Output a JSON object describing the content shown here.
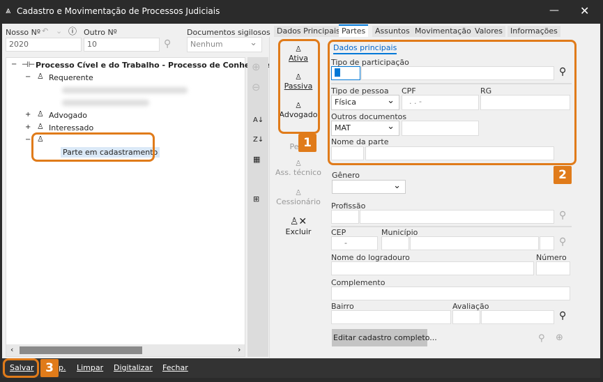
{
  "window": {
    "title": "Cadastro e Movimentação de Processos Judiciais",
    "minimize": "—",
    "maximize": "☐",
    "close": "✕"
  },
  "header": {
    "nosso_label": "Nosso Nº",
    "nosso_value": "2020",
    "outro_label": "Outro Nº",
    "outro_value": "10",
    "docs_label": "Documentos sigilosos",
    "docs_value": "Nenhum"
  },
  "tree": {
    "root": "Processo Cível e do Trabalho - Processo de Conhecimento",
    "nodes": [
      "Requerente",
      "Advogado",
      "Interessado"
    ],
    "new_child": "Parte em cadastramento",
    "expand": "+",
    "collapse": "−"
  },
  "tabs": [
    {
      "label": "Dados Principais"
    },
    {
      "label": "Partes"
    },
    {
      "label": "Assuntos"
    },
    {
      "label": "Movimentação"
    },
    {
      "label": "Valores"
    },
    {
      "label": "Informações"
    }
  ],
  "party_buttons": {
    "ativa": "Ativa",
    "passiva": "Passiva",
    "advogado": "Advogado",
    "perito": "Pe",
    "ass_tecnico": "Ass. técnico",
    "cessionario": "Cessionário",
    "excluir": "Excluir"
  },
  "form": {
    "subtab": "Dados principais",
    "tipo_participacao": "Tipo de participação",
    "tipo_pessoa": "Tipo de pessoa",
    "tipo_pessoa_value": "Física",
    "cpf": "CPF",
    "cpf_value": ".   .   -",
    "rg": "RG",
    "outros_docs": "Outros documentos",
    "outros_docs_value": "MAT",
    "nome_parte": "Nome da parte",
    "genero": "Gênero",
    "profissao": "Profissão",
    "cep": "CEP",
    "cep_value": "-",
    "municipio": "Município",
    "logradouro": "Nome do logradouro",
    "numero": "Número",
    "complemento": "Complemento",
    "bairro": "Bairro",
    "avaliacao": "Avaliação",
    "editar": "Editar cadastro completo..."
  },
  "badges": [
    "1",
    "2",
    "3"
  ],
  "footer": {
    "salvar": "Salvar",
    "imp": "p.",
    "limpar": "Limpar",
    "digitalizar": "Digitalizar",
    "fechar": "Fechar"
  },
  "colors": {
    "accent": "#e07b1a",
    "link": "#0066cc",
    "dark": "#2b2b2b"
  }
}
